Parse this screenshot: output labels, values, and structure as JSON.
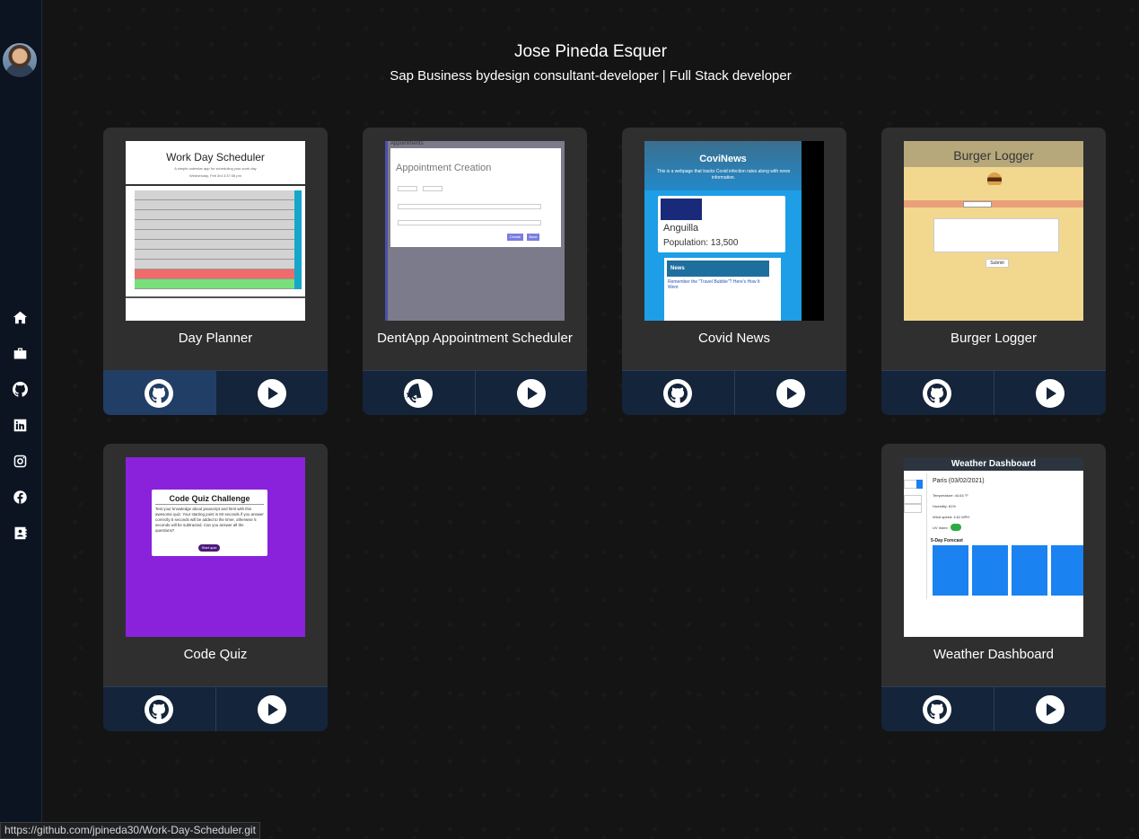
{
  "profile": {
    "name": "Jose Pineda Esquer",
    "role": "Sap Business bydesign consultant-developer | Full Stack developer"
  },
  "sidebar": {
    "items": [
      {
        "icon": "home-icon"
      },
      {
        "icon": "briefcase-icon"
      },
      {
        "icon": "github-icon"
      },
      {
        "icon": "linkedin-icon"
      },
      {
        "icon": "instagram-icon"
      },
      {
        "icon": "facebook-icon"
      },
      {
        "icon": "contact-icon"
      }
    ]
  },
  "projects": [
    {
      "title": "Day Planner",
      "thumb": {
        "heading": "Work Day Scheduler",
        "sub": "A simple calendar app for scheduling your work day",
        "date": "Wednesday, Feb 3rd 3:37:08 pm"
      }
    },
    {
      "title": "DentApp Appointment Scheduler",
      "thumb": {
        "heading": "Appointments",
        "modal_title": "Appointment Creation",
        "btn1": "Create",
        "btn2": "Back"
      }
    },
    {
      "title": "Covid News",
      "thumb": {
        "heading": "CoviNews",
        "desc": "This is a webpage that tracks Covid infection rates along with news information.",
        "country": "Anguilla",
        "population": "Population: 13,500",
        "news": "News",
        "news_link": "Remember the \"Travel Bubble\"? Here's How It Went"
      }
    },
    {
      "title": "Burger Logger",
      "thumb": {
        "heading": "Burger Logger",
        "button": "Submit"
      }
    },
    {
      "title": "Code Quiz",
      "thumb": {
        "heading": "Code Quiz Challenge",
        "text": "Test your knowledge about javascript and html with this awesome quiz. Your starting point is 60 seconds if you answer correctly 5 seconds will be added to the timer, otherwise 5 seconds will be subtracted. Can you answer all the questions?",
        "button": "Start quiz"
      }
    },
    {
      "title": "Weather Dashboard",
      "thumb": {
        "heading": "Weather Dashboard",
        "city": "Paris (03/02/2021)",
        "temp": "Temperature: 44.64 °F",
        "humidity": "Humidity: 81%",
        "wind": "Wind speed: 4.61 MPH",
        "uv": "UV Index:",
        "forecast": "5-Day Forecast"
      }
    }
  ],
  "status": {
    "url": "https://github.com/jpineda30/Work-Day-Scheduler.git"
  }
}
